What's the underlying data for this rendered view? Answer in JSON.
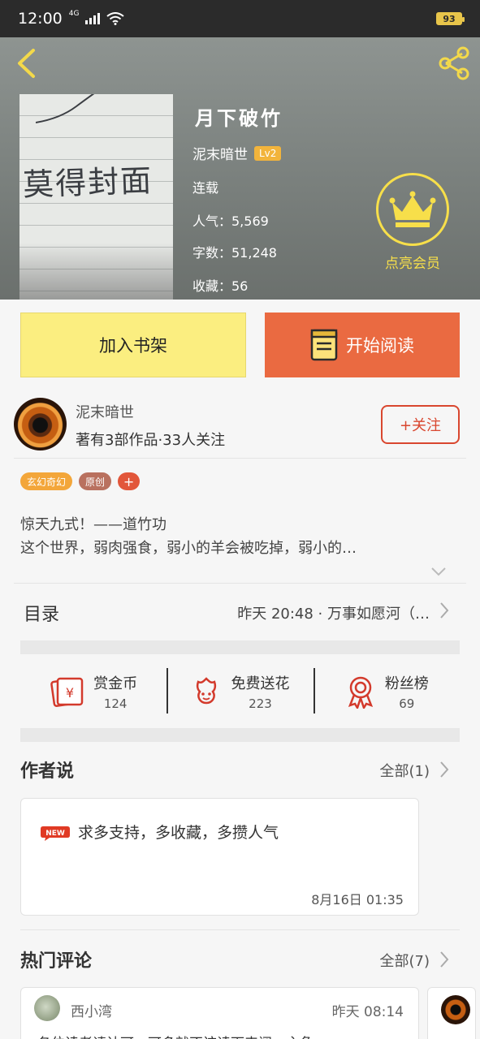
{
  "status_bar": {
    "time": "12:00",
    "network": "4G",
    "battery": "93"
  },
  "book": {
    "title": "月下破竹",
    "author": "泥末暗世",
    "level": "Lv2",
    "status": "连载",
    "popularity": "人气：5,569",
    "word_count": "字数：51,248",
    "favorites": "收藏：56",
    "cover_text": "莫得封面"
  },
  "vip": {
    "label": "点亮会员"
  },
  "actions": {
    "add_shelf": "加入书架",
    "start_read": "开始阅读"
  },
  "author_card": {
    "name": "泥末暗世",
    "stats": "著有3部作品·33人关注",
    "follow": "+关注"
  },
  "tags": [
    "玄幻奇幻",
    "原创"
  ],
  "tag_more": "+",
  "synopsis": {
    "line1": "惊天九式！——道竹功",
    "line2": "这个世界，弱肉强食，弱小的羊会被吃掉，弱小的…"
  },
  "catalog": {
    "title": "目录",
    "latest": "昨天 20:48 · 万事如愿河（…"
  },
  "stats": [
    {
      "label": "赏金币",
      "count": "124",
      "icon": "red-envelope-icon"
    },
    {
      "label": "免费送花",
      "count": "223",
      "icon": "flower-icon"
    },
    {
      "label": "粉丝榜",
      "count": "69",
      "icon": "medal-icon"
    }
  ],
  "author_says": {
    "title": "作者说",
    "more": "全部(1)",
    "badge": "NEW",
    "text": "求多支持，多收藏，多攒人气",
    "time": "8月16日 01:35"
  },
  "hot_comments": {
    "title": "热门评论",
    "more": "全部(7)",
    "items": [
      {
        "user": "西小湾",
        "time": "昨天 08:14",
        "text": "各位读者请认可，可多就不该读下来阅…主角"
      }
    ]
  },
  "colors": {
    "accent_orange": "#ea6a41",
    "shelf_yellow": "#fbee80",
    "follow_red": "#d9472f",
    "vip_yellow": "#f7df4a"
  }
}
